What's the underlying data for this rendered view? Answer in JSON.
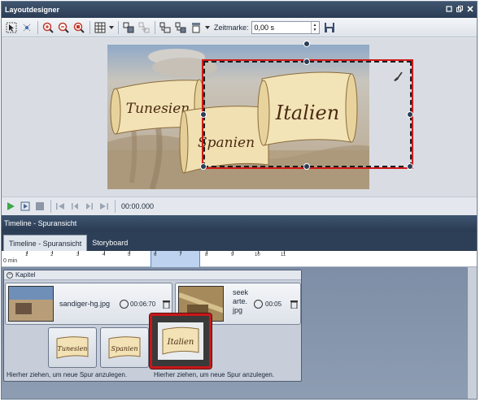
{
  "window": {
    "title": "Layoutdesigner",
    "controls": [
      "pin-icon",
      "restore-icon",
      "close-icon"
    ]
  },
  "toolbar": {
    "time_label": "Zeitmarke:",
    "time_value": "0,00 s"
  },
  "transport": {
    "time": "00:00.000"
  },
  "stage": {
    "scrolls": [
      "Tunesien",
      "Spanien",
      "Italien"
    ]
  },
  "timeline": {
    "panel_title": "Timeline - Spuransicht",
    "tabs": [
      {
        "label": "Timeline - Spuransicht",
        "active": true
      },
      {
        "label": "Storyboard",
        "active": false
      }
    ],
    "ruler_unit": "0 min",
    "ruler_labels": [
      "1",
      "2",
      "3",
      "4",
      "5",
      "6",
      "7",
      "8",
      "9",
      "10",
      "11"
    ],
    "chapter_label": "Kapitel",
    "clips": [
      {
        "name": "sandiger-hg.jpg",
        "duration": "00:06:70"
      },
      {
        "name": "seek arte. jpg",
        "name_lines": [
          "seek",
          "arte.",
          "jpg"
        ],
        "duration": "00:05"
      }
    ],
    "title_clips": [
      "Tunesien",
      "Spanien",
      "Italien"
    ],
    "hints": [
      "Hierher ziehen, um neue Spur anzulegen.",
      "Hierher ziehen, um neue Spur anzulegen."
    ]
  },
  "colors": {
    "title_bar": "#2b3d55",
    "selection": "#d11a1a",
    "ruler_highlight": "#bcd2ee"
  }
}
